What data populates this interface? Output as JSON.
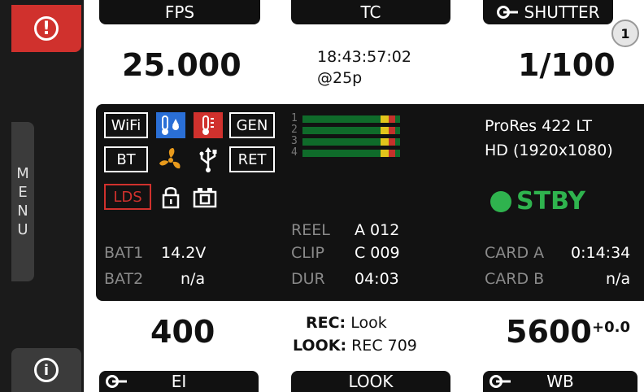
{
  "sidebar": {
    "menu_letters": [
      "M",
      "E",
      "N",
      "U"
    ],
    "warning_glyph": "!",
    "info_glyph": "i"
  },
  "tabs": {
    "fps": "FPS",
    "tc": "TC",
    "shutter": "SHUTTER",
    "ei": "EI",
    "look": "LOOK",
    "wb": "WB"
  },
  "values": {
    "fps": "25.000",
    "tc_time": "18:43:57:02",
    "tc_rate": "@25p",
    "shutter": "1/100",
    "ei": "400",
    "wb": "5600",
    "wb_offset": "+0.0"
  },
  "marker": "1",
  "status": {
    "wifi": "WiFi",
    "gen": "GEN",
    "bt": "BT",
    "ret": "RET",
    "lds": "LDS",
    "bat1_label": "BAT1",
    "bat1_value": "14.2V",
    "bat2_label": "BAT2",
    "bat2_value": "n/a"
  },
  "audio": {
    "channels": [
      "1",
      "2",
      "3",
      "4"
    ]
  },
  "clip": {
    "reel_label": "REEL",
    "reel_value": "A 012",
    "clip_label": "CLIP",
    "clip_value": "C 009",
    "dur_label": "DUR",
    "dur_value": "04:03"
  },
  "recording": {
    "codec": "ProRes 422 LT",
    "resolution": "HD (1920x1080)",
    "state": "STBY",
    "card_a_label": "CARD A",
    "card_a_value": "0:14:34",
    "card_b_label": "CARD B",
    "card_b_value": "n/a"
  },
  "look": {
    "rec_label": "REC:",
    "rec_value": "Look",
    "look_label": "LOOK:",
    "look_value": "REC 709"
  },
  "colors": {
    "warning": "#d0312d",
    "standby": "#2fb34e",
    "meter_green": "#0f6b2a",
    "meter_yellow": "#e2c51b",
    "meter_red": "#c3322b",
    "temp_blue": "#2a6fd6",
    "temp_red": "#d0312d",
    "fan_orange": "#e89a1c"
  }
}
